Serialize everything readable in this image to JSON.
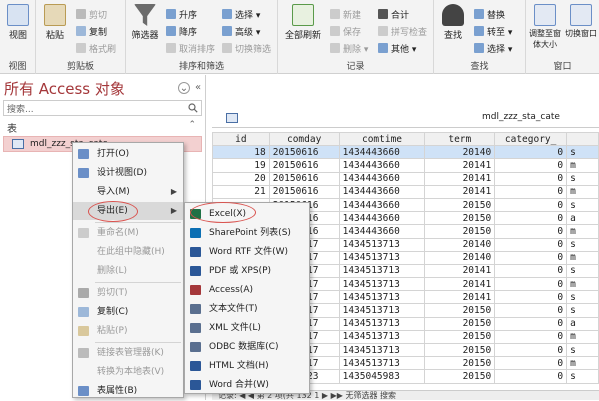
{
  "ribbon": {
    "view_group": {
      "label": "视图",
      "view_btn": "视图"
    },
    "clipboard": {
      "label": "剪贴板",
      "paste": "粘贴",
      "cut": "剪切",
      "copy": "复制",
      "format_painter": "格式刷"
    },
    "sort_filter": {
      "label": "排序和筛选",
      "filter": "筛选器",
      "ascending": "升序",
      "descending": "降序",
      "remove_sort": "取消排序",
      "selection": "选择",
      "advanced": "高级",
      "toggle_filter": "切换筛选"
    },
    "records": {
      "label": "记录",
      "refresh_all": "全部刷新",
      "new": "新建",
      "save": "保存",
      "delete": "删除",
      "totals": "合计",
      "spelling": "拼写检查",
      "more": "其他"
    },
    "find": {
      "label": "查找",
      "find": "查找",
      "replace": "替换",
      "goto": "转至",
      "select": "选择"
    },
    "window": {
      "label": "窗口",
      "fit_form": "调整至窗体大小",
      "switch_window": "切换窗口"
    }
  },
  "nav": {
    "title": "所有 Access 对象",
    "search_placeholder": "搜索...",
    "section": "表",
    "item": "mdl_zzz_sta_cate"
  },
  "doc": {
    "tab_title": "mdl_zzz_sta_cate",
    "columns": [
      "id",
      "comday",
      "comtime",
      "term",
      "category_",
      ""
    ],
    "rows": [
      [
        "18",
        "20150616",
        "1434443660",
        "20140",
        "0",
        "s"
      ],
      [
        "19",
        "20150616",
        "1434443660",
        "20141",
        "0",
        "m"
      ],
      [
        "20",
        "20150616",
        "1434443660",
        "20141",
        "0",
        "s"
      ],
      [
        "21",
        "20150616",
        "1434443660",
        "20141",
        "0",
        "m"
      ],
      [
        "",
        "20150616",
        "1434443660",
        "20150",
        "0",
        "s"
      ],
      [
        "",
        "20150616",
        "1434443660",
        "20150",
        "0",
        "a"
      ],
      [
        "",
        "20150616",
        "1434443660",
        "20150",
        "0",
        "m"
      ],
      [
        "",
        "20150617",
        "1434513713",
        "20140",
        "0",
        "s"
      ],
      [
        "",
        "20150617",
        "1434513713",
        "20140",
        "0",
        "m"
      ],
      [
        "",
        "20150617",
        "1434513713",
        "20141",
        "0",
        "s"
      ],
      [
        "",
        "20150617",
        "1434513713",
        "20141",
        "0",
        "m"
      ],
      [
        "",
        "20150617",
        "1434513713",
        "20141",
        "0",
        "s"
      ],
      [
        "",
        "20150617",
        "1434513713",
        "20150",
        "0",
        "s"
      ],
      [
        "",
        "20150617",
        "1434513713",
        "20150",
        "0",
        "a"
      ],
      [
        "",
        "20150617",
        "1434513713",
        "20150",
        "0",
        "m"
      ],
      [
        "",
        "20150617",
        "1434513713",
        "20150",
        "0",
        "s"
      ],
      [
        "",
        "20150617",
        "1434513713",
        "20150",
        "0",
        "m"
      ],
      [
        "",
        "20150623",
        "1435045983",
        "20150",
        "0",
        "s"
      ]
    ],
    "status": "记录: ◀ ◀ 第 2 项(共 132 1 ▶ ▶▶  无筛选器  搜索"
  },
  "context_menu": {
    "items": [
      {
        "label": "打开(O)",
        "disabled": false,
        "icon": "open-icon"
      },
      {
        "label": "设计视图(D)",
        "disabled": false,
        "icon": "design-icon"
      },
      {
        "label": "导入(M)",
        "disabled": false,
        "icon": "",
        "submenu": true
      },
      {
        "label": "导出(E)",
        "disabled": false,
        "icon": "",
        "submenu": true
      },
      {
        "label": "重命名(M)",
        "disabled": true,
        "icon": "rename-icon"
      },
      {
        "label": "在此组中隐藏(H)",
        "disabled": true,
        "icon": ""
      },
      {
        "label": "删除(L)",
        "disabled": true,
        "icon": ""
      },
      {
        "label": "剪切(T)",
        "disabled": true,
        "icon": "cut-icon"
      },
      {
        "label": "复制(C)",
        "disabled": false,
        "icon": "copy-icon"
      },
      {
        "label": "粘贴(P)",
        "disabled": true,
        "icon": "paste-icon"
      },
      {
        "label": "链接表管理器(K)",
        "disabled": true,
        "icon": "linkmgr-icon"
      },
      {
        "label": "转换为本地表(V)",
        "disabled": true,
        "icon": ""
      },
      {
        "label": "表属性(B)",
        "disabled": false,
        "icon": "props-icon"
      }
    ]
  },
  "export_menu": {
    "items": [
      {
        "label": "Excel(X)",
        "icon": "excel-icon"
      },
      {
        "label": "SharePoint 列表(S)",
        "icon": "sharepoint-icon"
      },
      {
        "label": "Word RTF 文件(W)",
        "icon": "word-icon"
      },
      {
        "label": "PDF 或 XPS(P)",
        "icon": "pdf-icon"
      },
      {
        "label": "Access(A)",
        "icon": "access-icon"
      },
      {
        "label": "文本文件(T)",
        "icon": "text-icon"
      },
      {
        "label": "XML 文件(L)",
        "icon": "xml-icon"
      },
      {
        "label": "ODBC 数据库(C)",
        "icon": "odbc-icon"
      },
      {
        "label": "HTML 文档(H)",
        "icon": "html-icon"
      },
      {
        "label": "Word 合并(W)",
        "icon": "wordmerge-icon"
      }
    ]
  },
  "colors": {
    "accent": "#a4373a",
    "highlight_row": "#cfe2f7",
    "annotation": "#d9534f"
  }
}
